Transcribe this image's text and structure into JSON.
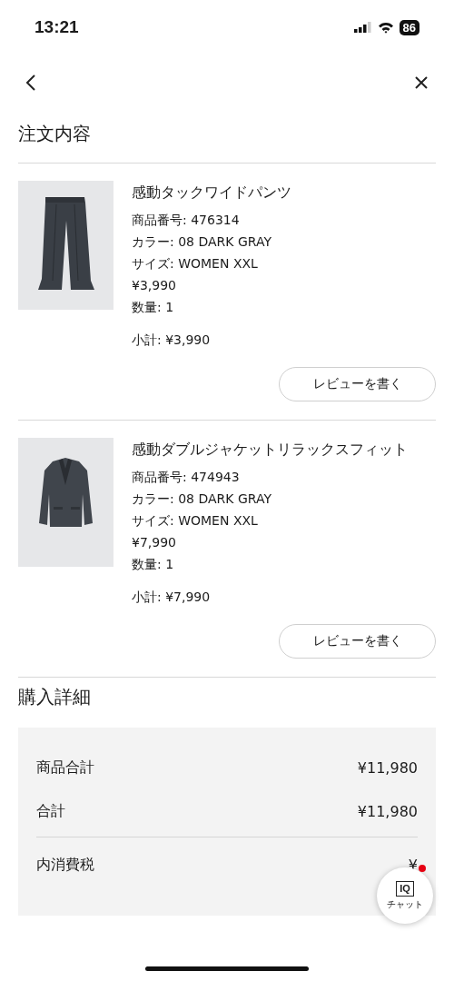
{
  "status_bar": {
    "time": "13:21",
    "battery": "86"
  },
  "section_title": "注文内容",
  "items": [
    {
      "kind": "pants",
      "name": "感動タックワイドパンツ",
      "details": [
        "商品番号: 476314",
        "カラー: 08 DARK GRAY",
        "サイズ: WOMEN XXL",
        "¥3,990",
        "数量: 1"
      ],
      "subtotal": "小計: ¥3,990",
      "review_button": "レビューを書く"
    },
    {
      "kind": "jacket",
      "name": "感動ダブルジャケットリラックスフィット",
      "details": [
        "商品番号: 474943",
        "カラー: 08 DARK GRAY",
        "サイズ: WOMEN XXL",
        "¥7,990",
        "数量: 1"
      ],
      "subtotal": "小計: ¥7,990",
      "review_button": "レビューを書く"
    }
  ],
  "purchase_title": "購入詳細",
  "summary": [
    {
      "label": "商品合計",
      "value": "¥11,980"
    },
    {
      "label": "合計",
      "value": "¥11,980"
    },
    {
      "label": "内消費税",
      "value": "¥"
    }
  ],
  "chat_button": {
    "logo": "IQ",
    "label": "チャット",
    "notification": true
  }
}
